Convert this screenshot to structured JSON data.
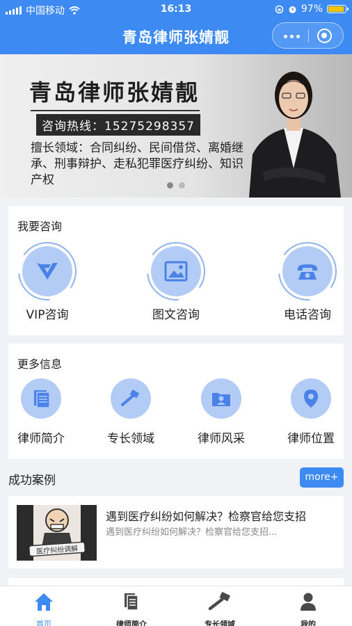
{
  "status_bar": {
    "carrier": "中国移动",
    "time": "16:13",
    "battery_percent": "97%",
    "battery_level": 0.97
  },
  "nav": {
    "title": "青岛律师张婧靓"
  },
  "banner": {
    "title": "青岛律师张婧靓",
    "hotline": "咨询热线：15275298357",
    "skills": "擅长领域：合同纠纷、民间借贷、离婚继承、刑事辩护、走私犯罪医疗纠纷、知识产权",
    "slide_count": 2,
    "active_slide": 1
  },
  "consult": {
    "title": "我要咨询",
    "items": [
      {
        "label": "VIP咨询",
        "icon": "vip-icon"
      },
      {
        "label": "图文咨询",
        "icon": "image-icon"
      },
      {
        "label": "电话咨询",
        "icon": "phone-icon"
      }
    ]
  },
  "more_info": {
    "title": "更多信息",
    "items": [
      {
        "label": "律师简介",
        "icon": "document-icon"
      },
      {
        "label": "专长领域",
        "icon": "gavel-icon"
      },
      {
        "label": "律师风采",
        "icon": "profile-folder-icon"
      },
      {
        "label": "律师位置",
        "icon": "location-icon"
      }
    ]
  },
  "cases": {
    "title": "成功案例",
    "more_label": "more+",
    "items": [
      {
        "title": "遇到医疗纠纷如何解决？检察官给您支招",
        "subtitle": "遇到医疗纠纷如何解决？检察官给您支招...",
        "thumb_caption": "医疗纠纷调解"
      }
    ]
  },
  "tabbar": {
    "items": [
      {
        "label": "首页",
        "icon": "home-icon",
        "active": true
      },
      {
        "label": "律师简介",
        "icon": "document-icon",
        "active": false
      },
      {
        "label": "专长领域",
        "icon": "gavel-icon",
        "active": false
      },
      {
        "label": "我的",
        "icon": "user-icon",
        "active": false
      }
    ]
  },
  "colors": {
    "accent": "#3d8bf2",
    "icon_bg": "#b3ccf6",
    "icon_fg": "#4a82e8"
  }
}
